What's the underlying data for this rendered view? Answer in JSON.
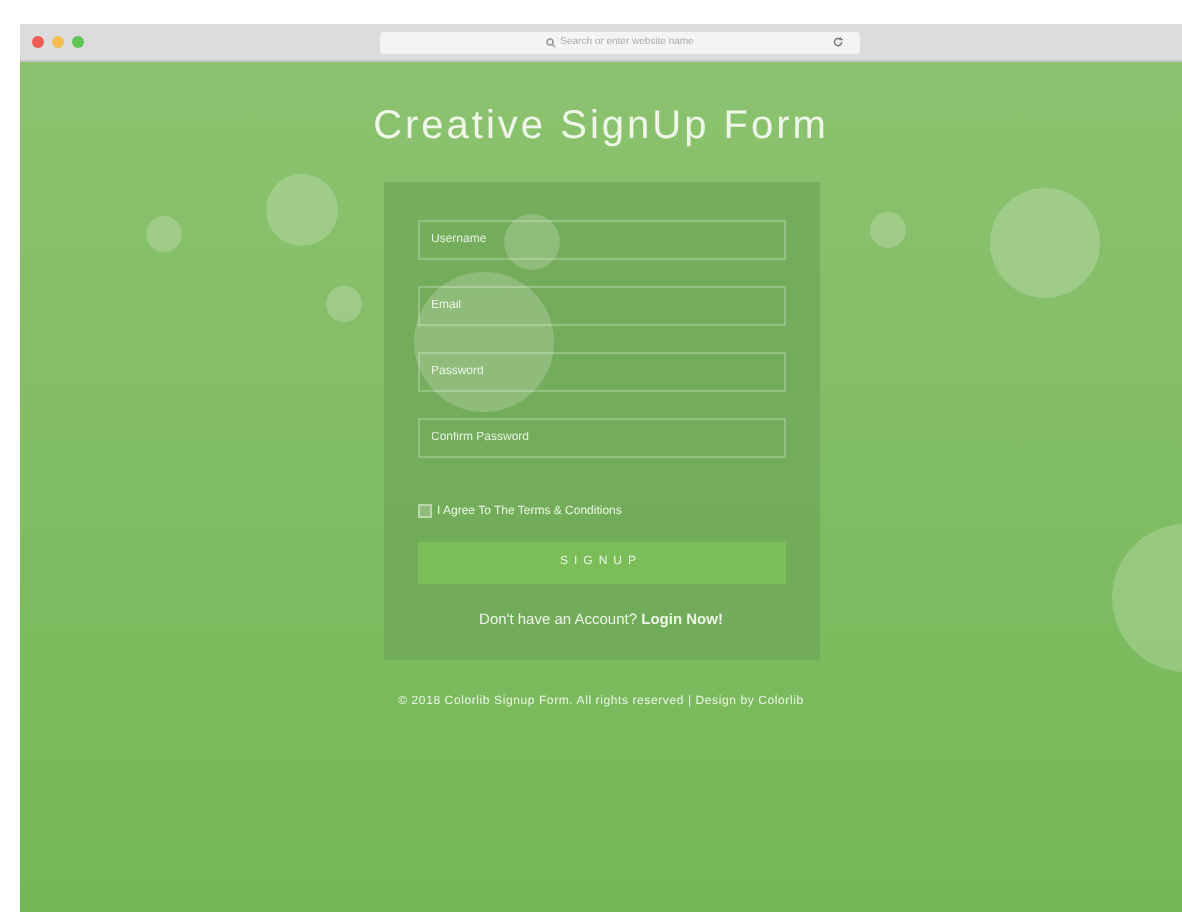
{
  "browser": {
    "address_placeholder": "Search or enter website name"
  },
  "title": "Creative SignUp Form",
  "fields": [
    {
      "placeholder": "Username"
    },
    {
      "placeholder": "Email"
    },
    {
      "placeholder": "Password"
    },
    {
      "placeholder": "Confirm Password"
    }
  ],
  "terms": {
    "label": "I Agree To The Terms & Conditions",
    "checked": false
  },
  "signup_button": "SIGNUP",
  "login_prompt": {
    "text": "Don't have an Account?",
    "link": "Login Now!"
  },
  "footer": {
    "text": "© 2018 Colorlib Signup Form. All rights reserved | Design by",
    "link": "Colorlib"
  }
}
